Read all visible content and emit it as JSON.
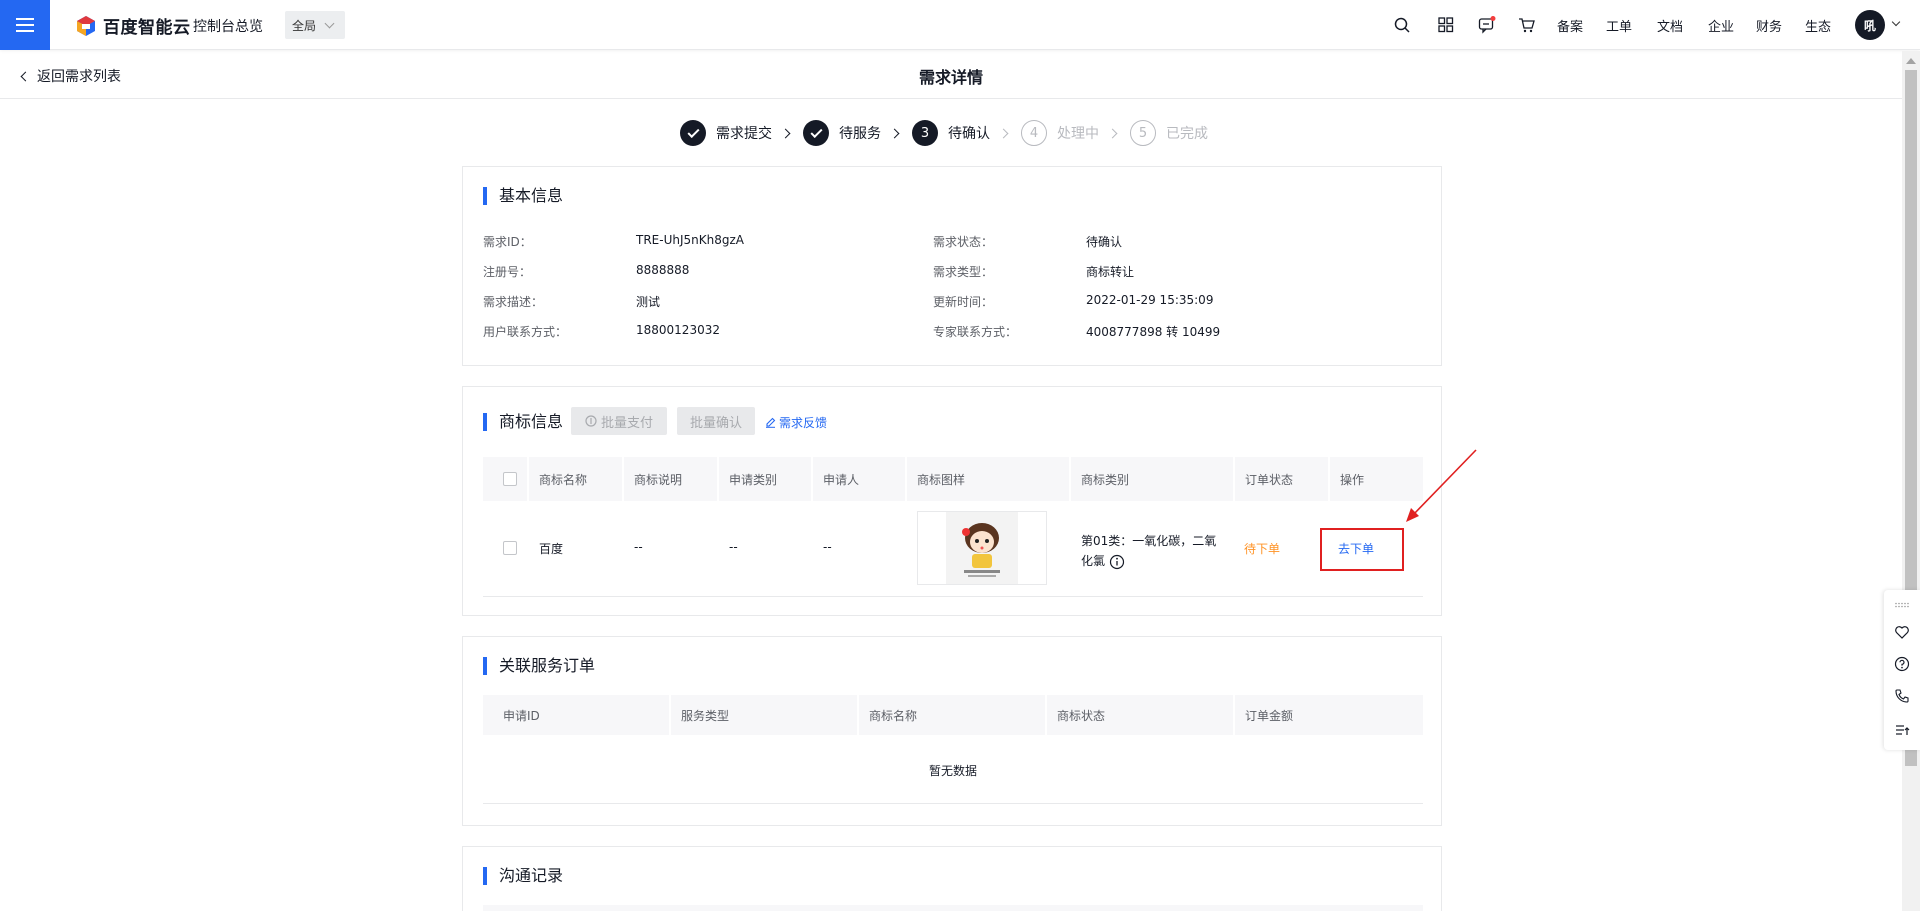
{
  "topbar": {
    "logo_text": "百度智能云",
    "console_label": "控制台总览",
    "region": "全局",
    "nav": [
      "备案",
      "工单",
      "文档",
      "企业",
      "财务",
      "生态"
    ],
    "avatar_text": "吼"
  },
  "subheader": {
    "back_label": "返回需求列表",
    "title": "需求详情"
  },
  "steps": [
    {
      "num": "",
      "label": "需求提交",
      "state": "done"
    },
    {
      "num": "",
      "label": "待服务",
      "state": "done"
    },
    {
      "num": "3",
      "label": "待确认",
      "state": "current"
    },
    {
      "num": "4",
      "label": "处理中",
      "state": "todo"
    },
    {
      "num": "5",
      "label": "已完成",
      "state": "todo"
    }
  ],
  "basic": {
    "title": "基本信息",
    "left": [
      {
        "label": "需求ID：",
        "value": "TRE-UhJ5nKh8gzA"
      },
      {
        "label": "注册号：",
        "value": "8888888"
      },
      {
        "label": "需求描述：",
        "value": "测试"
      },
      {
        "label": "用户联系方式：",
        "value": "18800123032"
      }
    ],
    "right": [
      {
        "label": "需求状态：",
        "value": "待确认"
      },
      {
        "label": "需求类型：",
        "value": "商标转让"
      },
      {
        "label": "更新时间：",
        "value": "2022-01-29 15:35:09"
      },
      {
        "label": "专家联系方式：",
        "value": "4008777898 转 10499"
      }
    ]
  },
  "trademark": {
    "title": "商标信息",
    "batch_pay": "批量支付",
    "batch_confirm": "批量确认",
    "feedback": "需求反馈",
    "columns": [
      "商标名称",
      "商标说明",
      "申请类别",
      "申请人",
      "商标图样",
      "商标类别",
      "订单状态",
      "操作"
    ],
    "row": {
      "name": "百度",
      "desc": "--",
      "category": "--",
      "applicant": "--",
      "class_line1": "第01类：一氧化碳，二氧",
      "class_line2": "化氯",
      "status": "待下单",
      "action": "去下单"
    }
  },
  "orders": {
    "title": "关联服务订单",
    "columns": [
      "申请ID",
      "服务类型",
      "商标名称",
      "商标状态",
      "订单金额"
    ],
    "empty": "暂无数据"
  },
  "communication": {
    "title": "沟通记录"
  },
  "colors": {
    "accent": "#2468f2",
    "pending": "#ff9326",
    "highlight": "#e02020"
  }
}
